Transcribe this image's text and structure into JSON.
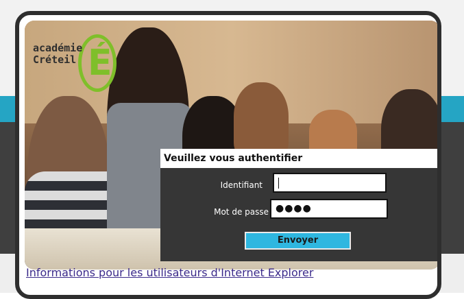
{
  "logo": {
    "line1": "académie",
    "line2": "Créteil",
    "letter": "É"
  },
  "auth": {
    "title": "Veuillez vous authentifier",
    "identifiant_label": "Identifiant",
    "password_label": "Mot de passe",
    "identifiant_value": "",
    "password_value": "●●●●",
    "submit_label": "Envoyer"
  },
  "footer": {
    "ie_link": "Informations pour les utilisateurs d'Internet Explorer"
  },
  "colors": {
    "accent": "#2fb7e0",
    "band": "#25a5c4",
    "panel": "#363636",
    "link": "#3b2a8a"
  }
}
